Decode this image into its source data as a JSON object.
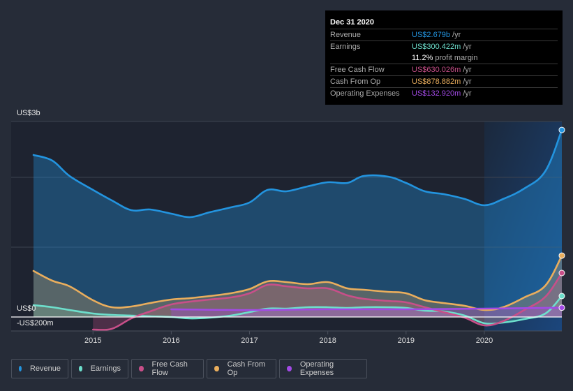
{
  "tooltip": {
    "date": "Dec 31 2020",
    "rows": [
      {
        "label": "Revenue",
        "value": "US$2.679b",
        "unit": "/yr",
        "color": "#2394df"
      },
      {
        "label": "Earnings",
        "value": "US$300.422m",
        "unit": "/yr",
        "color": "#6ddfcc"
      },
      {
        "label": "",
        "value": "11.2%",
        "unit": "profit margin",
        "color": "#ffffff"
      },
      {
        "label": "Free Cash Flow",
        "value": "US$630.026m",
        "unit": "/yr",
        "color": "#c84f89"
      },
      {
        "label": "Cash From Op",
        "value": "US$878.882m",
        "unit": "/yr",
        "color": "#eaae5d"
      },
      {
        "label": "Operating Expenses",
        "value": "US$132.920m",
        "unit": "/yr",
        "color": "#a24ae6"
      }
    ]
  },
  "legend": [
    {
      "label": "Revenue",
      "color": "#2394df"
    },
    {
      "label": "Earnings",
      "color": "#6ddfcc"
    },
    {
      "label": "Free Cash Flow",
      "color": "#c84f89"
    },
    {
      "label": "Cash From Op",
      "color": "#eaae5d"
    },
    {
      "label": "Operating Expenses",
      "color": "#a24ae6"
    }
  ],
  "chart_data": {
    "type": "area",
    "title": "",
    "xlabel": "",
    "ylabel": "",
    "y_unit": "US$ billions",
    "ylim": [
      -0.2,
      2.8
    ],
    "xlim": [
      2014.24,
      2020.99
    ],
    "y_tick_labels": [
      {
        "value": 2.8,
        "label": "US$3b"
      },
      {
        "value": 0,
        "label": "US$0"
      },
      {
        "value": -0.2,
        "label": "-US$200m"
      }
    ],
    "x_ticks": [
      2015,
      2016,
      2017,
      2018,
      2019,
      2020
    ],
    "x_tick_labels": [
      "2015",
      "2016",
      "2017",
      "2018",
      "2019",
      "2020"
    ],
    "grid": true,
    "legend_position": "bottom-left",
    "highlight_range": [
      2020.0,
      2020.99
    ],
    "series": [
      {
        "name": "Revenue",
        "color": "#2394df",
        "x": [
          2014.24,
          2014.48,
          2014.7,
          2015.0,
          2015.24,
          2015.49,
          2015.73,
          2016.0,
          2016.24,
          2016.49,
          2016.76,
          2017.0,
          2017.23,
          2017.47,
          2017.74,
          2018.0,
          2018.25,
          2018.46,
          2018.77,
          2019.0,
          2019.24,
          2019.48,
          2019.75,
          2020.0,
          2020.24,
          2020.51,
          2020.78,
          2020.99
        ],
        "values": [
          2.32,
          2.24,
          2.02,
          1.82,
          1.67,
          1.53,
          1.54,
          1.48,
          1.43,
          1.5,
          1.57,
          1.64,
          1.82,
          1.8,
          1.87,
          1.93,
          1.92,
          2.02,
          2.01,
          1.92,
          1.8,
          1.76,
          1.69,
          1.6,
          1.69,
          1.84,
          2.09,
          2.679
        ]
      },
      {
        "name": "Earnings",
        "color": "#6ddfcc",
        "x": [
          2014.24,
          2014.48,
          2014.7,
          2015.0,
          2015.24,
          2015.49,
          2015.73,
          2016.0,
          2016.24,
          2016.49,
          2016.76,
          2017.0,
          2017.23,
          2017.47,
          2017.74,
          2018.0,
          2018.25,
          2018.46,
          2018.77,
          2019.0,
          2019.24,
          2019.48,
          2019.75,
          2020.0,
          2020.24,
          2020.51,
          2020.78,
          2020.99
        ],
        "values": [
          0.17,
          0.14,
          0.1,
          0.05,
          0.03,
          0.02,
          0.01,
          0.0,
          -0.02,
          -0.01,
          0.02,
          0.07,
          0.12,
          0.12,
          0.14,
          0.14,
          0.13,
          0.14,
          0.14,
          0.13,
          0.09,
          0.08,
          0.02,
          -0.09,
          -0.08,
          -0.03,
          0.05,
          0.3
        ]
      },
      {
        "name": "Free Cash Flow",
        "color": "#c84f89",
        "x": [
          2015.0,
          2015.24,
          2015.49,
          2015.73,
          2016.0,
          2016.24,
          2016.49,
          2016.76,
          2017.0,
          2017.23,
          2017.47,
          2017.74,
          2018.0,
          2018.25,
          2018.46,
          2018.77,
          2019.0,
          2019.24,
          2019.48,
          2019.75,
          2020.0,
          2020.24,
          2020.51,
          2020.78,
          2020.99
        ],
        "values": [
          -0.18,
          -0.17,
          -0.02,
          0.08,
          0.18,
          0.22,
          0.25,
          0.28,
          0.34,
          0.46,
          0.44,
          0.41,
          0.41,
          0.31,
          0.26,
          0.23,
          0.21,
          0.14,
          0.07,
          -0.01,
          -0.12,
          -0.06,
          0.1,
          0.29,
          0.63
        ]
      },
      {
        "name": "Cash From Op",
        "color": "#eaae5d",
        "x": [
          2014.24,
          2014.48,
          2014.7,
          2015.0,
          2015.24,
          2015.49,
          2015.73,
          2016.0,
          2016.24,
          2016.49,
          2016.76,
          2017.0,
          2017.23,
          2017.47,
          2017.74,
          2018.0,
          2018.25,
          2018.46,
          2018.77,
          2019.0,
          2019.24,
          2019.48,
          2019.75,
          2020.0,
          2020.24,
          2020.51,
          2020.78,
          2020.99
        ],
        "values": [
          0.66,
          0.52,
          0.44,
          0.24,
          0.14,
          0.15,
          0.2,
          0.25,
          0.27,
          0.3,
          0.34,
          0.4,
          0.51,
          0.5,
          0.47,
          0.5,
          0.41,
          0.39,
          0.36,
          0.34,
          0.24,
          0.2,
          0.16,
          0.1,
          0.14,
          0.28,
          0.45,
          0.879
        ]
      },
      {
        "name": "Operating Expenses",
        "color": "#a24ae6",
        "x": [
          2016.0,
          2017.0,
          2018.0,
          2019.0,
          2020.0,
          2020.99
        ],
        "values": [
          0.11,
          0.1,
          0.11,
          0.11,
          0.12,
          0.133
        ]
      }
    ]
  }
}
